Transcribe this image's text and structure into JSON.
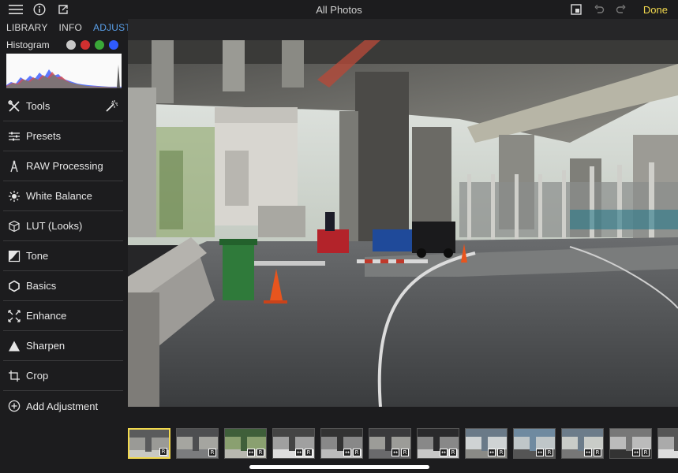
{
  "header": {
    "title": "All Photos",
    "done_label": "Done",
    "icons": [
      "menu-icon",
      "info-icon",
      "export-icon",
      "compare-icon",
      "undo-icon",
      "redo-icon"
    ]
  },
  "sidebar": {
    "tabs": [
      {
        "label": "LIBRARY",
        "active": false
      },
      {
        "label": "INFO",
        "active": false
      },
      {
        "label": "ADJUST",
        "active": true
      }
    ],
    "histogram_label": "Histogram",
    "channel_colors": [
      "#c8c8c8",
      "#d03030",
      "#3aa838",
      "#2f5bff"
    ],
    "items": [
      {
        "label": "Tools",
        "icon": "tools-icon"
      },
      {
        "label": "Presets",
        "icon": "presets-icon"
      },
      {
        "label": "RAW Processing",
        "icon": "raw-icon"
      },
      {
        "label": "White Balance",
        "icon": "sun-icon"
      },
      {
        "label": "LUT (Looks)",
        "icon": "cube-icon"
      },
      {
        "label": "Tone",
        "icon": "tone-icon"
      },
      {
        "label": "Basics",
        "icon": "hexagon-icon"
      },
      {
        "label": "Enhance",
        "icon": "enhance-icon"
      },
      {
        "label": "Sharpen",
        "icon": "triangle-icon"
      },
      {
        "label": "Crop",
        "icon": "crop-icon"
      },
      {
        "label": "Add Adjustment",
        "icon": "add-circle-icon"
      }
    ]
  },
  "colors": {
    "accent": "#f2d94e",
    "active_tab": "#5aa0ea",
    "panel": "#1c1c1e"
  },
  "filmstrip": {
    "badge_raw": "R",
    "thumbs": [
      {
        "selected": true,
        "compare": false
      },
      {
        "selected": false,
        "compare": false
      },
      {
        "selected": false,
        "compare": true
      },
      {
        "selected": false,
        "compare": true
      },
      {
        "selected": false,
        "compare": true
      },
      {
        "selected": false,
        "compare": true
      },
      {
        "selected": false,
        "compare": true
      },
      {
        "selected": false,
        "compare": true
      },
      {
        "selected": false,
        "compare": true
      },
      {
        "selected": false,
        "compare": true
      },
      {
        "selected": false,
        "compare": true
      },
      {
        "selected": false,
        "compare": true
      }
    ]
  }
}
